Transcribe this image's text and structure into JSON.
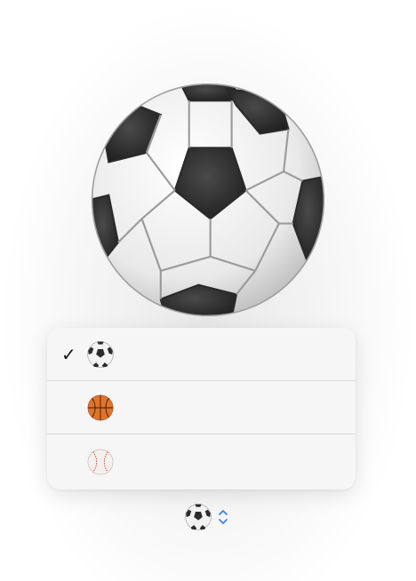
{
  "selected_emoji": "soccer-ball",
  "menu": {
    "items": [
      {
        "emoji": "soccer-ball",
        "checked": true,
        "check_glyph": "✓"
      },
      {
        "emoji": "basketball",
        "checked": false,
        "check_glyph": ""
      },
      {
        "emoji": "baseball",
        "checked": false,
        "check_glyph": ""
      }
    ]
  },
  "colors": {
    "accent": "#3b82f6",
    "menu_bg": "#f6f6f6",
    "divider": "#d9d9d9"
  }
}
